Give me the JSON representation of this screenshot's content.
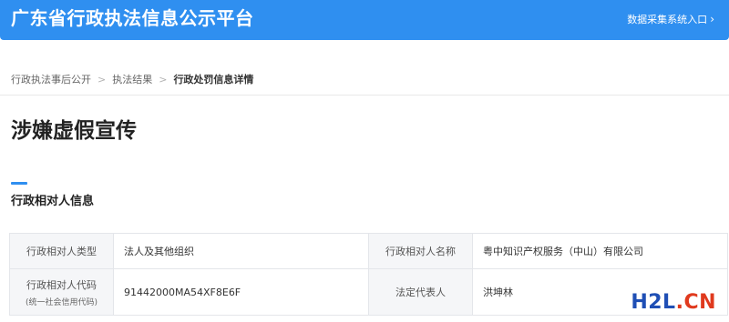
{
  "header": {
    "site_title": "广东省行政执法信息公示平台",
    "entry_link": "数据采集系统入口",
    "entry_icon": "chevron-right-icon"
  },
  "breadcrumb": {
    "items": [
      "行政执法事后公开",
      "执法结果",
      "行政处罚信息详情"
    ],
    "separator_icon": "chevron-right-icon"
  },
  "page": {
    "title": "涉嫌虚假宣传"
  },
  "section": {
    "title": "行政相对人信息",
    "accent_color": "#2f8ff0"
  },
  "table": {
    "rows": [
      {
        "label_1": "行政相对人类型",
        "value_1": "法人及其他组织",
        "label_2": "行政相对人名称",
        "value_2": "粤中知识产权服务（中山）有限公司"
      },
      {
        "label_1": "行政相对人代码",
        "label_1_sub": "(统一社会信用代码)",
        "value_1": "91442000MA54XF8E6F",
        "label_2": "法定代表人",
        "value_2": "洪坤林"
      }
    ]
  },
  "watermark": {
    "part_a": "H2L",
    "dot": ".",
    "part_b": "CN"
  },
  "colors": {
    "header_bg": "#2f8ff0",
    "label_cell_bg": "#f5f6f8",
    "border": "#e4e6ea"
  }
}
